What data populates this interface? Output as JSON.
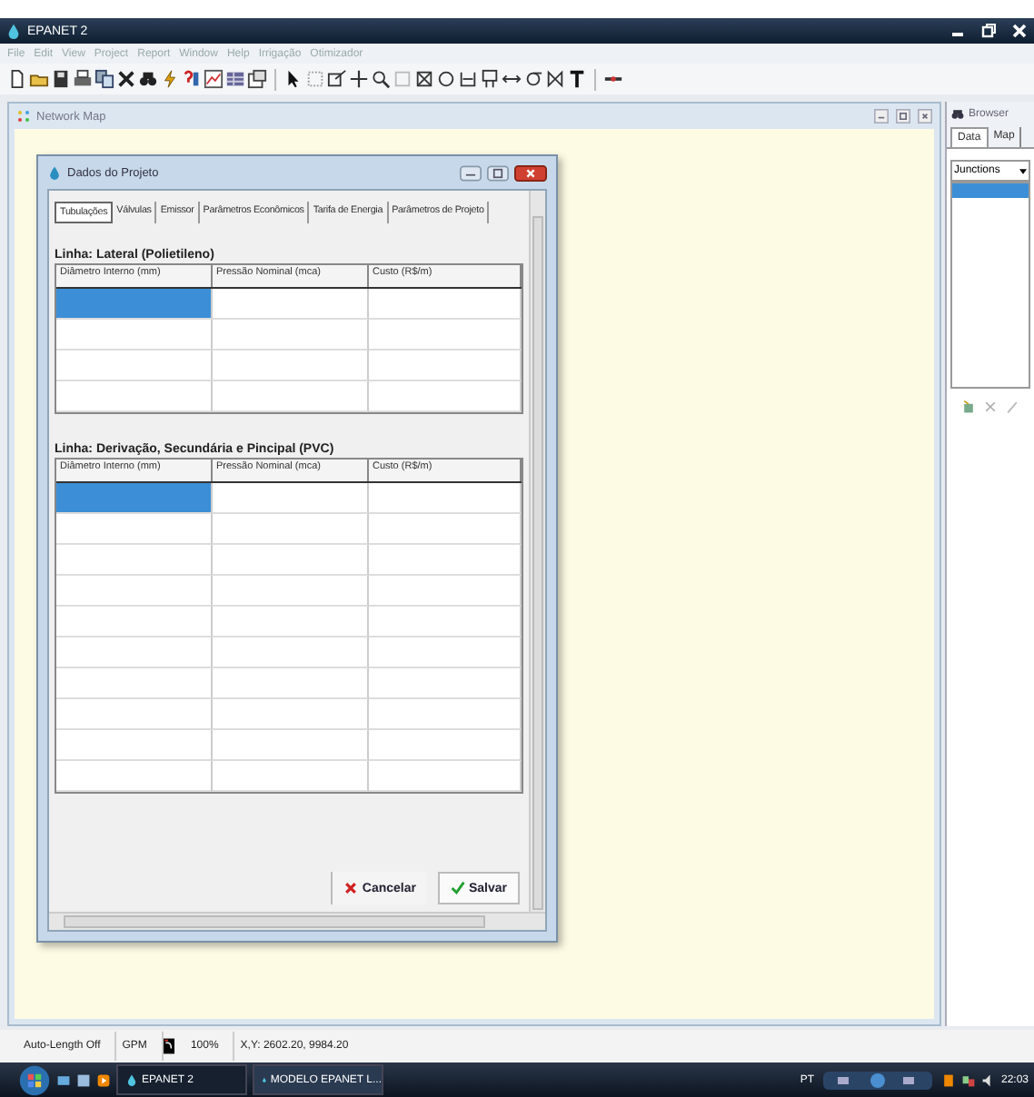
{
  "window": {
    "title": "EPANET 2"
  },
  "menu": [
    "File",
    "Edit",
    "View",
    "Project",
    "Report",
    "Window",
    "Help",
    "Irrigação",
    "Otimizador"
  ],
  "network_map": {
    "title": "Network Map"
  },
  "dialog": {
    "title": "Dados do Projeto",
    "tabs": [
      {
        "label": "Tubulações",
        "selected": true
      },
      {
        "label": "Válvulas",
        "selected": false
      },
      {
        "label": "Emissor",
        "selected": false
      },
      {
        "label": "Parâmetros Econômicos",
        "selected": false
      },
      {
        "label": "Tarifa de Energia",
        "selected": false
      },
      {
        "label": "Parâmetros de Projeto",
        "selected": false
      }
    ],
    "tables": [
      {
        "title": "Linha: Lateral (Polietileno)",
        "columns": [
          "Diâmetro Interno (mm)",
          "Pressão Nominal (mca)",
          "Custo (R$/m)"
        ],
        "rows": [
          {
            "cells": [
              {
                "selected": true
              },
              {
                "selected": false
              },
              {
                "selected": false
              }
            ]
          },
          {
            "cells": [
              {
                "selected": false
              },
              {
                "selected": false
              },
              {
                "selected": false
              }
            ]
          },
          {
            "cells": [
              {
                "selected": false
              },
              {
                "selected": false
              },
              {
                "selected": false
              }
            ]
          },
          {
            "cells": [
              {
                "selected": false
              },
              {
                "selected": false
              },
              {
                "selected": false
              }
            ]
          }
        ]
      },
      {
        "title": "Linha: Derivação, Secundária e Pincipal (PVC)",
        "columns": [
          "Diâmetro Interno (mm)",
          "Pressão Nominal (mca)",
          "Custo (R$/m)"
        ],
        "rows": [
          {
            "cells": [
              {
                "selected": true
              },
              {
                "selected": false
              },
              {
                "selected": false
              }
            ]
          },
          {
            "cells": [
              {
                "selected": false
              },
              {
                "selected": false
              },
              {
                "selected": false
              }
            ]
          },
          {
            "cells": [
              {
                "selected": false
              },
              {
                "selected": false
              },
              {
                "selected": false
              }
            ]
          },
          {
            "cells": [
              {
                "selected": false
              },
              {
                "selected": false
              },
              {
                "selected": false
              }
            ]
          },
          {
            "cells": [
              {
                "selected": false
              },
              {
                "selected": false
              },
              {
                "selected": false
              }
            ]
          },
          {
            "cells": [
              {
                "selected": false
              },
              {
                "selected": false
              },
              {
                "selected": false
              }
            ]
          },
          {
            "cells": [
              {
                "selected": false
              },
              {
                "selected": false
              },
              {
                "selected": false
              }
            ]
          },
          {
            "cells": [
              {
                "selected": false
              },
              {
                "selected": false
              },
              {
                "selected": false
              }
            ]
          },
          {
            "cells": [
              {
                "selected": false
              },
              {
                "selected": false
              },
              {
                "selected": false
              }
            ]
          },
          {
            "cells": [
              {
                "selected": false
              },
              {
                "selected": false
              },
              {
                "selected": false
              }
            ]
          }
        ]
      }
    ],
    "buttons": [
      {
        "label": "Cancelar",
        "kind": "cancel"
      },
      {
        "label": "Salvar",
        "kind": "save"
      }
    ]
  },
  "browser": {
    "title": "Browser",
    "tabs": [
      {
        "label": "Data",
        "selected": true
      },
      {
        "label": "Map",
        "selected": false
      }
    ],
    "dropdown": "Junctions",
    "items": [
      {
        "selected": true
      }
    ]
  },
  "status_bar": [
    "Auto-Length Off",
    "GPM",
    "100%",
    "X,Y: 2602.20, 9984.20"
  ],
  "taskbar": {
    "tasks": [
      {
        "label": "EPANET 2",
        "selected": true
      },
      {
        "label": "MODELO EPANET L...",
        "selected": false
      }
    ],
    "language": "PT",
    "clock": "22:03"
  }
}
